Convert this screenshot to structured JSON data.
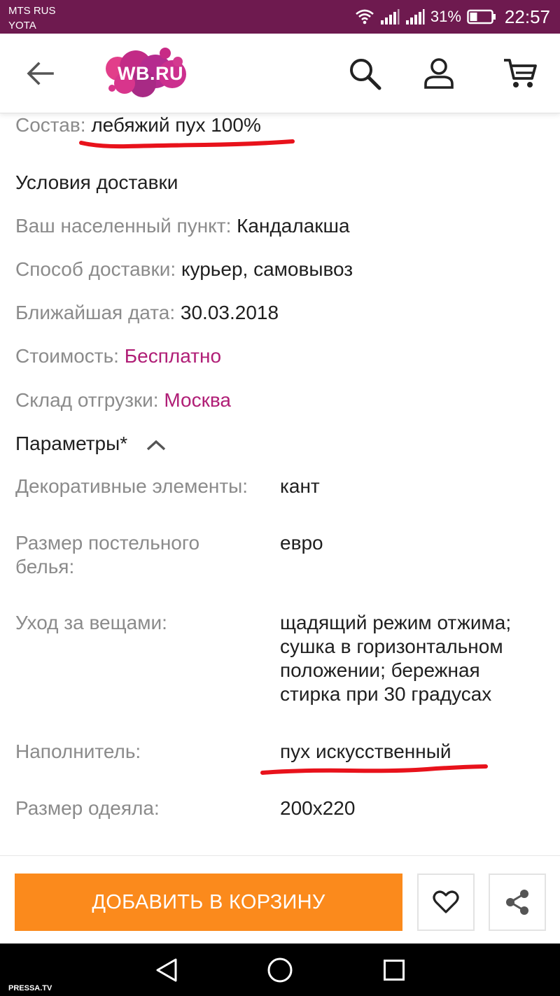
{
  "status_bar": {
    "carrier_1": "MTS RUS",
    "carrier_2": "YOTA",
    "battery_percent": "31%",
    "time": "22:57",
    "icons": [
      "wifi-icon",
      "signal-icon",
      "signal-icon",
      "battery-icon"
    ]
  },
  "header": {
    "logo_text": "WB.RU",
    "icons": [
      "back-arrow-icon",
      "search-icon",
      "user-icon",
      "cart-icon"
    ]
  },
  "composition": {
    "label": "Состав:",
    "value": "лебяжий пух 100%"
  },
  "delivery": {
    "title": "Условия доставки",
    "rows": [
      {
        "label": "Ваш населенный пункт:",
        "value": "Кандалакша"
      },
      {
        "label": "Способ доставки:",
        "value": "курьер, самовывоз"
      },
      {
        "label": "Ближайшая дата:",
        "value": "30.03.2018"
      },
      {
        "label": "Стоимость:",
        "value": "Бесплатно"
      },
      {
        "label": "Склад отгрузки:",
        "value": "Москва"
      }
    ]
  },
  "params": {
    "title": "Параметры*",
    "rows": [
      {
        "label": "Декоративные элементы:",
        "value": "кант"
      },
      {
        "label": "Размер постельного белья:",
        "value": "евро"
      },
      {
        "label": "Уход за вещами:",
        "value": "щадящий режим отжима; сушка в горизонтальном положении; бережная стирка при 30 градусах"
      },
      {
        "label": "Наполнитель:",
        "value": "пух искусственный"
      },
      {
        "label": "Размер одеяла:",
        "value": "200x220"
      }
    ]
  },
  "actions": {
    "add_to_cart": "ДОБАВИТЬ В КОРЗИНУ",
    "icons": [
      "heart-icon",
      "share-icon"
    ]
  },
  "nav_icons": [
    "back-triangle-icon",
    "home-circle-icon",
    "recents-square-icon"
  ],
  "watermark": "PRESSA.TV",
  "colors": {
    "status_bar": "#6e1a4f",
    "accent": "#b01e76",
    "cart_button": "#fb8a1c",
    "annotation": "#e8121b"
  }
}
